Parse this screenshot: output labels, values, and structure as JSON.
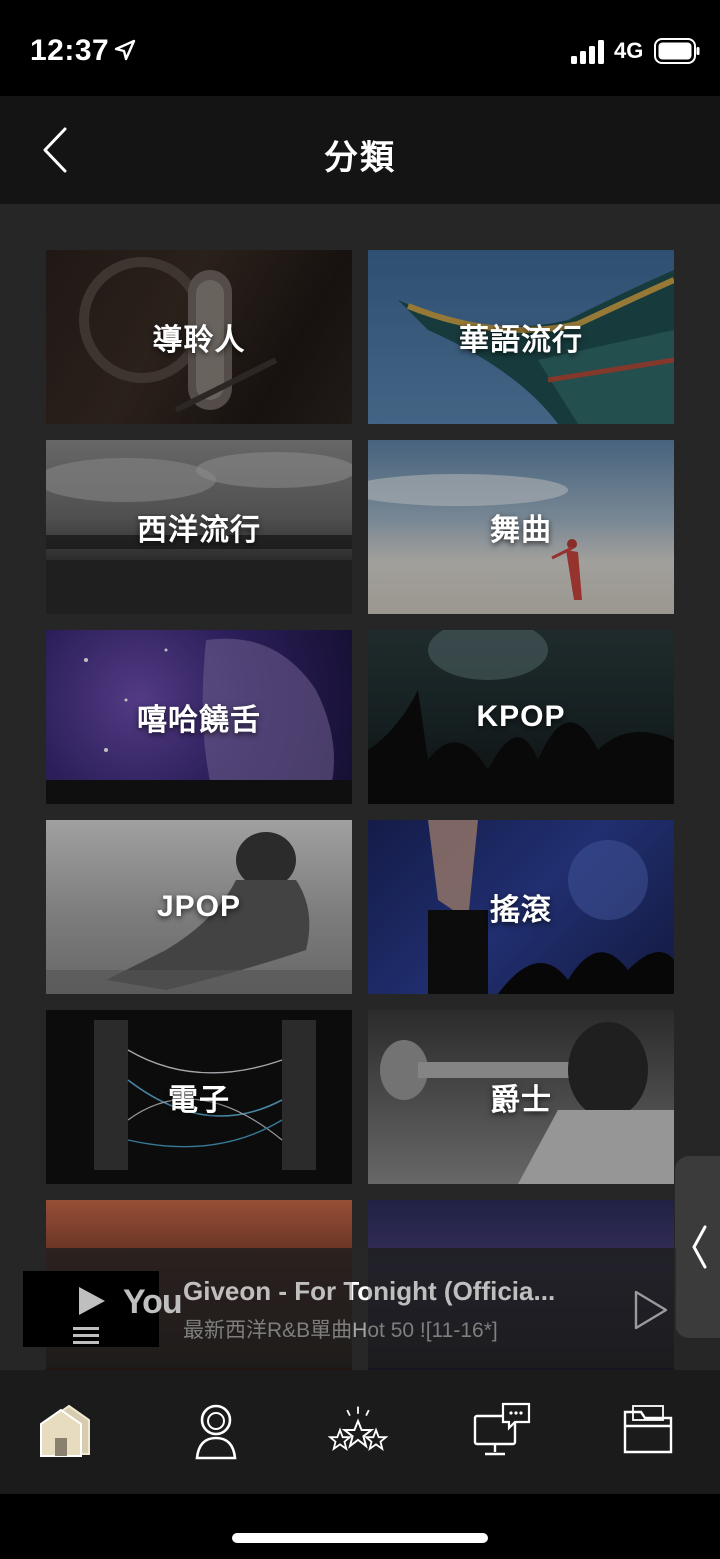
{
  "status_bar": {
    "time": "12:37",
    "network": "4G"
  },
  "header": {
    "title": "分類"
  },
  "categories": [
    {
      "label": "導聆人"
    },
    {
      "label": "華語流行"
    },
    {
      "label": "西洋流行"
    },
    {
      "label": "舞曲"
    },
    {
      "label": "嘻哈饒舌"
    },
    {
      "label": "KPOP"
    },
    {
      "label": "JPOP"
    },
    {
      "label": "搖滾"
    },
    {
      "label": "電子"
    },
    {
      "label": "爵士"
    },
    {
      "label": ""
    },
    {
      "label": ""
    }
  ],
  "player": {
    "title": "Giveon - For Tonight (Officia...",
    "subtitle": "最新西洋R&B單曲Hot 50 ![11-16*]",
    "thumb_text": "You"
  },
  "bottom_nav": {
    "items": [
      "home-icon",
      "profile-icon",
      "rankings-stars-icon",
      "chat-monitor-icon",
      "folder-icon"
    ],
    "active_color": "#e8dcc0"
  }
}
